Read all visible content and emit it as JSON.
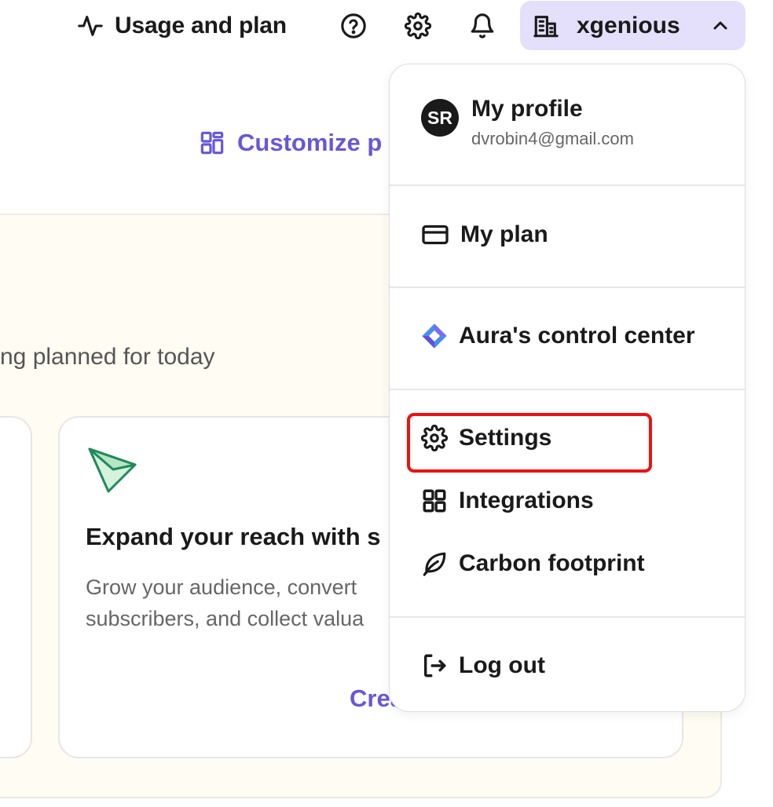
{
  "topbar": {
    "usage_label": "Usage and plan",
    "help_icon": "help-circle-icon",
    "settings_icon": "gear-icon",
    "notifications_icon": "bell-icon",
    "account_name": "xgenious",
    "account_bg": "#e4e0fb"
  },
  "background": {
    "customize_label": "Customize p",
    "planned_text": "ng planned for today",
    "card": {
      "title": "Expand your reach with s",
      "description": "Grow your audience, convert subscribers, and collect valua",
      "cta": "Crea"
    }
  },
  "menu": {
    "profile": {
      "initials": "SR",
      "name": "My profile",
      "email": "dvrobin4@gmail.com"
    },
    "items": [
      {
        "label": "My plan",
        "icon": "credit-card-icon"
      },
      {
        "label": "Aura's control center",
        "icon": "aura-diamond-icon"
      },
      {
        "label": "Settings",
        "icon": "gear-icon",
        "highlighted": true
      },
      {
        "label": "Integrations",
        "icon": "grid-icon"
      },
      {
        "label": "Carbon footprint",
        "icon": "leaf-icon"
      },
      {
        "label": "Log out",
        "icon": "logout-icon"
      }
    ]
  },
  "colors": {
    "accent": "#6658d8",
    "highlight": "#ee1111",
    "plane_green": "#1f8a5b"
  }
}
